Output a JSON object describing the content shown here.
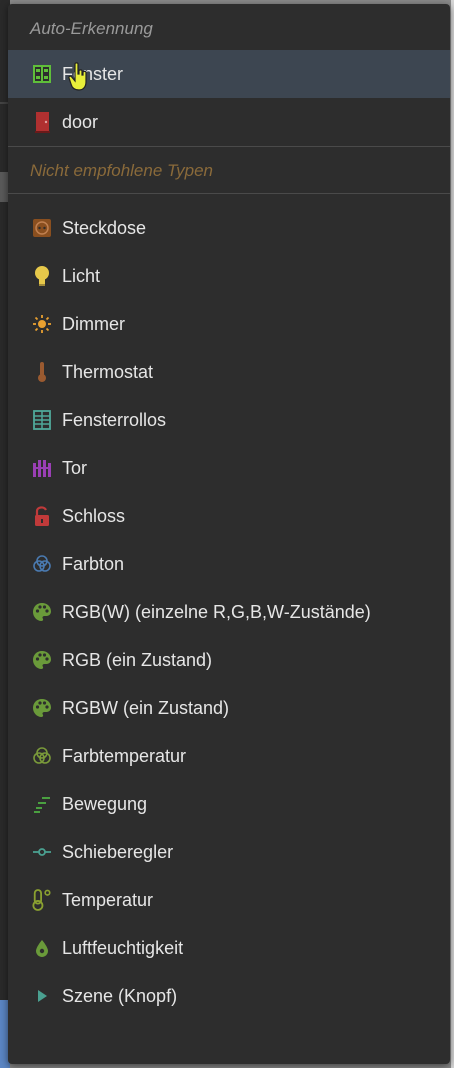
{
  "menu": {
    "auto_header": "Auto-Erkennung",
    "auto_items": [
      {
        "label": "Fenster",
        "icon": "window-icon",
        "color": "#5fbf3a",
        "selected": true
      },
      {
        "label": "door",
        "icon": "door-icon",
        "color": "#b03030"
      }
    ],
    "notrec_header": "Nicht empfohlene Typen",
    "items": [
      {
        "label": "Steckdose",
        "icon": "socket-icon",
        "color": "#8a4f1f"
      },
      {
        "label": "Licht",
        "icon": "lightbulb-icon",
        "color": "#e6c84a"
      },
      {
        "label": "Dimmer",
        "icon": "sun-icon",
        "color": "#e8a030"
      },
      {
        "label": "Thermostat",
        "icon": "thermometer-icon",
        "color": "#9a5a30"
      },
      {
        "label": "Fensterrollos",
        "icon": "blinds-icon",
        "color": "#4fa89a"
      },
      {
        "label": "Tor",
        "icon": "gate-icon",
        "color": "#9a3fb5"
      },
      {
        "label": "Schloss",
        "icon": "lock-icon",
        "color": "#c03a3a"
      },
      {
        "label": "Farbton",
        "icon": "color-circles-icon",
        "color": "#4a7ab0"
      },
      {
        "label": "RGB(W) (einzelne R,G,B,W-Zustände)",
        "icon": "palette-icon",
        "color": "#6a9a3a"
      },
      {
        "label": "RGB (ein Zustand)",
        "icon": "palette-icon",
        "color": "#6a9a3a"
      },
      {
        "label": "RGBW (ein Zustand)",
        "icon": "palette-icon",
        "color": "#6a9a3a"
      },
      {
        "label": "Farbtemperatur",
        "icon": "color-temp-icon",
        "color": "#7a9a3a"
      },
      {
        "label": "Bewegung",
        "icon": "motion-icon",
        "color": "#4aa040"
      },
      {
        "label": "Schieberegler",
        "icon": "slider-icon",
        "color": "#4aa090"
      },
      {
        "label": "Temperatur",
        "icon": "temperature-icon",
        "color": "#8aa030"
      },
      {
        "label": "Luftfeuchtigkeit",
        "icon": "droplet-icon",
        "color": "#6a9a3a"
      },
      {
        "label": "Szene (Knopf)",
        "icon": "play-icon",
        "color": "#4aa090"
      }
    ]
  }
}
